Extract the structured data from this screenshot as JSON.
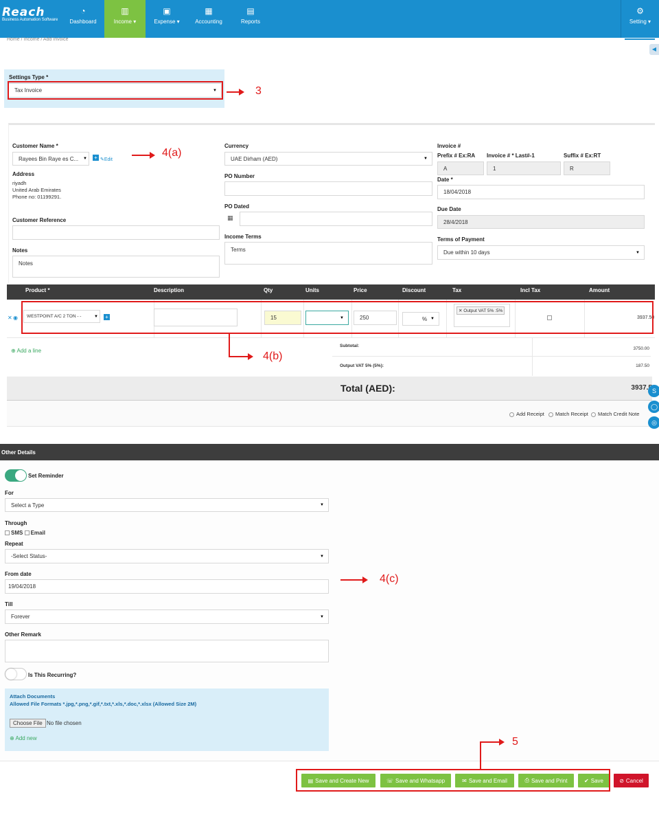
{
  "app": {
    "logo": "Reach",
    "tagline": "Business Automation Software"
  },
  "nav": {
    "items": [
      {
        "label": "Dashboard",
        "icon": "dashboard-icon"
      },
      {
        "label": "Income ▾",
        "icon": "bar-chart-icon"
      },
      {
        "label": "Expense ▾",
        "icon": "money-icon"
      },
      {
        "label": "Accounting",
        "icon": "calculator-icon"
      },
      {
        "label": "Reports",
        "icon": "file-icon"
      }
    ],
    "setting": {
      "label": "Setting ▾",
      "icon": "gear-icon"
    }
  },
  "breadcrumb": "Home / Income / Add Invoice",
  "settings_type": {
    "label": "Settings Type *",
    "value": "Tax Invoice"
  },
  "customer": {
    "name_label": "Customer Name *",
    "name_value": "Rayees Bin Raye es C...",
    "edit_label": "Edit",
    "address_label": "Address",
    "address_lines": [
      "riyadh",
      "United Arab Emirates",
      "Phone no: 01199291."
    ],
    "reference_label": "Customer Reference",
    "notes_label": "Notes",
    "notes_value": "Notes"
  },
  "currency": {
    "label": "Currency",
    "value": "UAE Dirham (AED)"
  },
  "po_number": {
    "label": "PO Number"
  },
  "po_dated": {
    "label": "PO Dated"
  },
  "income_terms": {
    "label": "Income Terms",
    "value": "Terms"
  },
  "invoice": {
    "label": "Invoice #",
    "prefix_label": "Prefix # Ex:RA",
    "prefix_value": "A",
    "number_label": "Invoice # * Last#-1",
    "number_value": "1",
    "suffix_label": "Suffix # Ex:RT",
    "suffix_value": "R",
    "date_label": "Date *",
    "date_value": "18/04/2018",
    "due_label": "Due Date",
    "due_value": "28/4/2018",
    "terms_label": "Terms of Payment",
    "terms_value": "Due within 10 days"
  },
  "table": {
    "headers": [
      "Product *",
      "Description",
      "Qty",
      "Units",
      "Price",
      "Discount",
      "Tax",
      "Incl Tax",
      "Amount"
    ],
    "row": {
      "product": "WESTPOINT A/C 2 TON - -",
      "qty": "15",
      "price": "250",
      "discount_unit": "%",
      "tax_tag": "Output VAT 5% :5%",
      "amount": "3937.50"
    },
    "add_line": "Add a line",
    "subtotal_label": "Subtotal:",
    "subtotal_value": "3750.00",
    "vat_label": "Output VAT 5% (5%):",
    "vat_value": "187.50",
    "total_label": "Total (AED):",
    "total_value": "3937.5"
  },
  "receipt_options": [
    "Add Receipt",
    "Match Receipt",
    "Match Credit Note"
  ],
  "other": {
    "title": "Other Details",
    "reminder_label": "Set Reminder",
    "for_label": "For",
    "for_value": "Select a Type",
    "through_label": "Through",
    "sms_label": "SMS",
    "email_label": "Email",
    "repeat_label": "Repeat",
    "repeat_value": "-Select Status-",
    "from_label": "From date",
    "from_value": "19/04/2018",
    "till_label": "Till",
    "till_value": "Forever",
    "remark_label": "Other Remark",
    "recurring_label": "Is This Recurring?",
    "attach_title": "Attach Documents",
    "attach_formats": "Allowed File Formats *.jpg,*.png,*.gif,*.txt,*.xls,*.doc,*.xlsx (Allowed Size 2M)",
    "choose_file": "Choose File",
    "no_file": "No file chosen",
    "add_new": "Add new"
  },
  "buttons": {
    "save_create_new": "Save and Create New",
    "save_whatsapp": "Save and Whatsapp",
    "save_email": "Save and Email",
    "save_print": "Save and Print",
    "save": "Save",
    "cancel": "Cancel"
  },
  "annotations": {
    "a3": "3",
    "a4a": "4(a)",
    "a4b": "4(b)",
    "a4c": "4(c)",
    "a5": "5"
  },
  "colors": {
    "nav": "#1a8fcf",
    "active": "#7dc242",
    "annotation": "#e01a1a",
    "table_header": "#3d3d3d"
  }
}
